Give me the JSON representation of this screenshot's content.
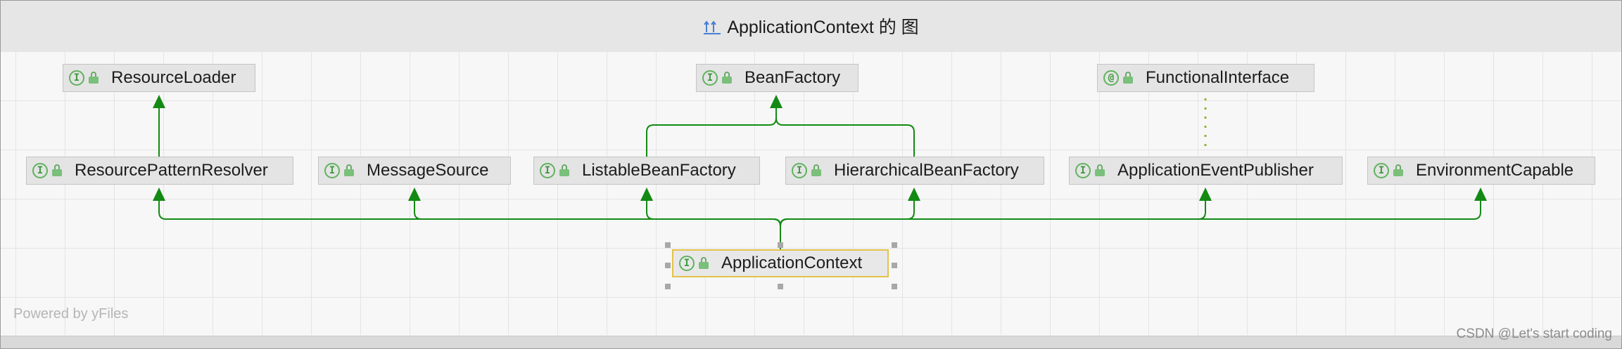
{
  "window": {
    "title": "ApplicationContext 的 图"
  },
  "nodes": {
    "resource_loader": {
      "label": "ResourceLoader",
      "kind_icon": "interface-icon",
      "badge": "I"
    },
    "bean_factory": {
      "label": "BeanFactory",
      "kind_icon": "interface-icon",
      "badge": "I"
    },
    "functional_interface": {
      "label": "FunctionalInterface",
      "kind_icon": "annotation-icon",
      "badge": "@"
    },
    "resource_pattern_resolver": {
      "label": "ResourcePatternResolver",
      "kind_icon": "interface-icon",
      "badge": "I"
    },
    "message_source": {
      "label": "MessageSource",
      "kind_icon": "interface-icon",
      "badge": "I"
    },
    "listable_bean_factory": {
      "label": "ListableBeanFactory",
      "kind_icon": "interface-icon",
      "badge": "I"
    },
    "hierarchical_bean_factory": {
      "label": "HierarchicalBeanFactory",
      "kind_icon": "interface-icon",
      "badge": "I"
    },
    "application_event_publisher": {
      "label": "ApplicationEventPublisher",
      "kind_icon": "interface-icon",
      "badge": "I"
    },
    "environment_capable": {
      "label": "EnvironmentCapable",
      "kind_icon": "interface-icon",
      "badge": "I"
    },
    "application_context": {
      "label": "ApplicationContext",
      "kind_icon": "interface-icon",
      "badge": "I"
    }
  },
  "edges": [
    {
      "from": "resource_pattern_resolver",
      "to": "resource_loader",
      "style": "extends"
    },
    {
      "from": "listable_bean_factory",
      "to": "bean_factory",
      "style": "extends"
    },
    {
      "from": "hierarchical_bean_factory",
      "to": "bean_factory",
      "style": "extends"
    },
    {
      "from": "application_event_publisher",
      "to": "functional_interface",
      "style": "annotated"
    },
    {
      "from": "application_context",
      "to": "resource_pattern_resolver",
      "style": "extends"
    },
    {
      "from": "application_context",
      "to": "message_source",
      "style": "extends"
    },
    {
      "from": "application_context",
      "to": "listable_bean_factory",
      "style": "extends"
    },
    {
      "from": "application_context",
      "to": "hierarchical_bean_factory",
      "style": "extends"
    },
    {
      "from": "application_context",
      "to": "application_event_publisher",
      "style": "extends"
    },
    {
      "from": "application_context",
      "to": "environment_capable",
      "style": "extends"
    }
  ],
  "colors": {
    "edge": "#138a13",
    "selection": "#e3c24a",
    "node_fill": "#e4e4e4"
  },
  "footer": {
    "powered_by": "Powered by yFiles",
    "watermark": "CSDN @Let's start coding"
  }
}
